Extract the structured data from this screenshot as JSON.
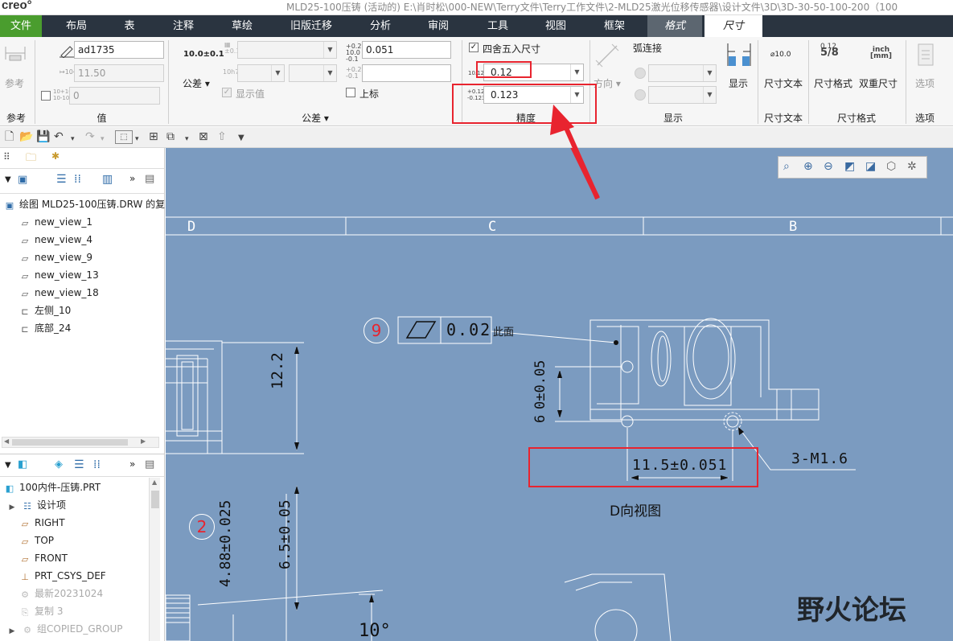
{
  "titlebar": {
    "logo": "creo°",
    "window_title": "MLD25-100压铸 (活动的) E:\\肖时松\\000-NEW\\Terry文件\\Terry工作文件\\2-MLD25激光位移传感器\\设计文件\\3D\\3D-30-50-100-200（100"
  },
  "menu": {
    "tabs": [
      "文件",
      "布局",
      "表",
      "注释",
      "草绘",
      "旧版迁移",
      "分析",
      "审阅",
      "工具",
      "视图",
      "框架",
      "格式",
      "尺寸"
    ]
  },
  "ribbon": {
    "reference": {
      "label": "参考",
      "group": "参考"
    },
    "value": {
      "name_value": "ad1735",
      "nominal_value": "11.50",
      "override_value": "0",
      "group": "值"
    },
    "tolerance": {
      "label": "公差",
      "show_value_label": "显示值",
      "group": "公差",
      "upper_value": "0.051",
      "lower_value": "",
      "superscript_label": "上标"
    },
    "precision": {
      "round_label": "四舍五入尺寸",
      "decimal_value": "0.12",
      "tolerance_decimal_value": "0.123",
      "group": "精度"
    },
    "display": {
      "arc_label": "弧连接",
      "direction_label": "方向",
      "show_label": "显示",
      "group": "显示"
    },
    "dimtext": {
      "button": "尺寸文本",
      "icon_text": "⌀10.0",
      "group": "尺寸文本"
    },
    "dimformat": {
      "format_label": "尺寸格式",
      "dual_label": "双重尺寸",
      "group": "尺寸格式",
      "frac_top": "0.12",
      "frac_bottom": "5/8",
      "inch_text": "inch\n[mm]"
    },
    "options": {
      "label": "选项",
      "group": "选项"
    },
    "tiny": {
      "tol_sym": "10.0±0.1",
      "upper_tag": "+0.2\n10.0\n-0.1",
      "lower_tag": "+0.2\n-0.1",
      "plusminus": "±0.1",
      "h7": "10h7",
      "prec1": "10.123",
      "prec2_top": "+0.123",
      "prec2_bot": "-0.123",
      "ovr1": "10+10",
      "ovr2": "10-10"
    }
  },
  "sidebar": {
    "model_tree_root": "绘图 MLD25-100压铸.DRW 的复",
    "drawing_items": [
      "new_view_1",
      "new_view_4",
      "new_view_9",
      "new_view_13",
      "new_view_18",
      "左侧_10",
      "底部_24"
    ],
    "part_root": "100内件-压铸.PRT",
    "part_items": [
      "设计项",
      "RIGHT",
      "TOP",
      "FRONT",
      "PRT_CSYS_DEF",
      "最新20231024",
      "复制 3",
      "组COPIED_GROUP"
    ]
  },
  "drawing": {
    "zones": [
      "D",
      "C",
      "B"
    ],
    "balloon_9": "9",
    "flatness_value": "0.02",
    "surface_note": "此面",
    "dim_12_2": "12.2",
    "dim_0_05": "0±0.05",
    "dim_6": "6",
    "dim_11_5": "11.5±0.051",
    "thread_note": "3-M1.6",
    "view_label": "D向视图",
    "balloon_2": "2",
    "dim_4_88": "4.88±0.025",
    "dim_6_5": "6.5±0.05",
    "angle": "10°",
    "watermark": "野火论坛"
  },
  "colors": {
    "menubar": "#2a3440",
    "file_tab": "#4a9d2e",
    "canvas": "#7b9bc0",
    "highlight": "#e8242f"
  }
}
